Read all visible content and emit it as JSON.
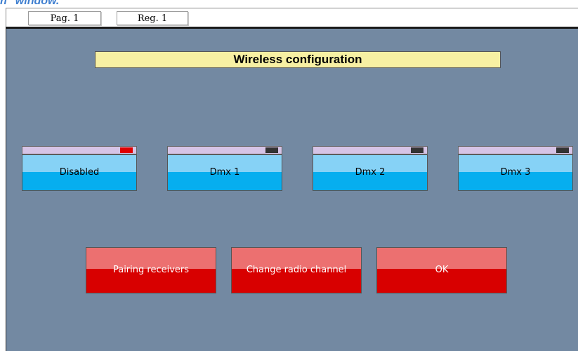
{
  "caption": "n\" window.",
  "tabs": {
    "page": "Pag. 1",
    "register": "Reg. 1"
  },
  "title": "Wireless configuration",
  "modes": [
    {
      "label": "Disabled",
      "indicator_active": true
    },
    {
      "label": "Dmx 1",
      "indicator_active": false
    },
    {
      "label": "Dmx 2",
      "indicator_active": false
    },
    {
      "label": "Dmx 3",
      "indicator_active": false
    }
  ],
  "actions": {
    "pairing": "Pairing receivers",
    "change_channel": "Change radio channel",
    "ok": "OK"
  },
  "colors": {
    "panel": "#7389a2",
    "title_bg": "#f7f0a3",
    "mode_button": "#06aeef",
    "action_button": "#d80000",
    "indicator_on": "#e00000",
    "indicator_off": "#333333"
  }
}
